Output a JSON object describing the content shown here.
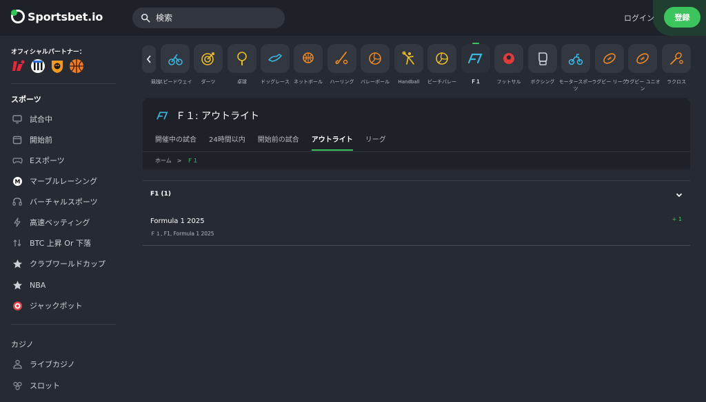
{
  "header": {
    "logo_text": "Sportsbet.io",
    "search_placeholder": "検索",
    "login_label": "ログイン",
    "register_label": "登録"
  },
  "sidebar": {
    "partner_title": "オフィシャルパートナー：",
    "partner_logos": [
      "laliga-logo",
      "newcastle-logo",
      "hull-city-logo",
      "basketball-club-logo"
    ],
    "sports_title": "スポーツ",
    "sports_items": [
      {
        "label": "試合中",
        "icon": "monitor-icon"
      },
      {
        "label": "開始前",
        "icon": "calendar-icon"
      },
      {
        "label": "Eスポーツ",
        "icon": "gamepad-icon"
      },
      {
        "label": "マーブルレーシング",
        "icon": "marble-icon"
      },
      {
        "label": "バーチャルスポーツ",
        "icon": "vr-headset-icon"
      },
      {
        "label": "高速ベッティング",
        "icon": "lightning-icon"
      },
      {
        "label": "BTC 上昇 Or 下落",
        "icon": "arrows-icon"
      },
      {
        "label": "クラブワールドカップ",
        "icon": "star-icon"
      },
      {
        "label": "NBA",
        "icon": "star-icon"
      },
      {
        "label": "ジャックポット",
        "icon": "target-icon"
      }
    ],
    "casino_title": "カジノ",
    "casino_items": [
      {
        "label": "ライブカジノ",
        "icon": "dealer-icon"
      },
      {
        "label": "スロット",
        "icon": "slot-icon"
      }
    ]
  },
  "sports_carousel": [
    {
      "label": "競技",
      "icon": "partial-icon"
    },
    {
      "label": "スピードウェイ",
      "icon": "speedway-icon"
    },
    {
      "label": "ダーツ",
      "icon": "darts-icon"
    },
    {
      "label": "卓球",
      "icon": "table-tennis-icon"
    },
    {
      "label": "ドッグレース",
      "icon": "greyhound-icon"
    },
    {
      "label": "ネットボール",
      "icon": "netball-icon"
    },
    {
      "label": "ハーリング",
      "icon": "hurling-icon"
    },
    {
      "label": "バレーボール",
      "icon": "volleyball-icon"
    },
    {
      "label": "Handball",
      "icon": "handball-icon"
    },
    {
      "label": "ビーチバレー",
      "icon": "beach-volleyball-icon"
    },
    {
      "label": "Ｆ１",
      "icon": "f1-icon",
      "active": true
    },
    {
      "label": "フットサル",
      "icon": "futsal-icon"
    },
    {
      "label": "ボクシング",
      "icon": "boxing-icon"
    },
    {
      "label": "モータースポーツ",
      "icon": "motorsport-icon"
    },
    {
      "label": "ラグビー リーグ",
      "icon": "rugby-league-icon"
    },
    {
      "label": "ラグビー ユニオン",
      "icon": "rugby-union-icon"
    },
    {
      "label": "ラクロス",
      "icon": "lacrosse-icon"
    }
  ],
  "main": {
    "title": "Ｆ１: アウトライト",
    "tabs": [
      {
        "label": "開催中の試合"
      },
      {
        "label": "24時間以内"
      },
      {
        "label": "開始前の試合"
      },
      {
        "label": "アウトライト",
        "active": true
      },
      {
        "label": "リーグ"
      }
    ],
    "breadcrumb": {
      "home": "ホーム",
      "separator": ">",
      "current": "Ｆ１"
    },
    "group": {
      "title": "F1 (1)"
    },
    "event": {
      "name": "Formula 1 2025",
      "sub": "Ｆ１, F1, Formula 1 2025",
      "count": "+ 1"
    }
  },
  "colors": {
    "accent": "#3dc55d",
    "sport_icon": "#f08a24",
    "f1_icon": "#3ab6e0",
    "background": "#262b33"
  }
}
